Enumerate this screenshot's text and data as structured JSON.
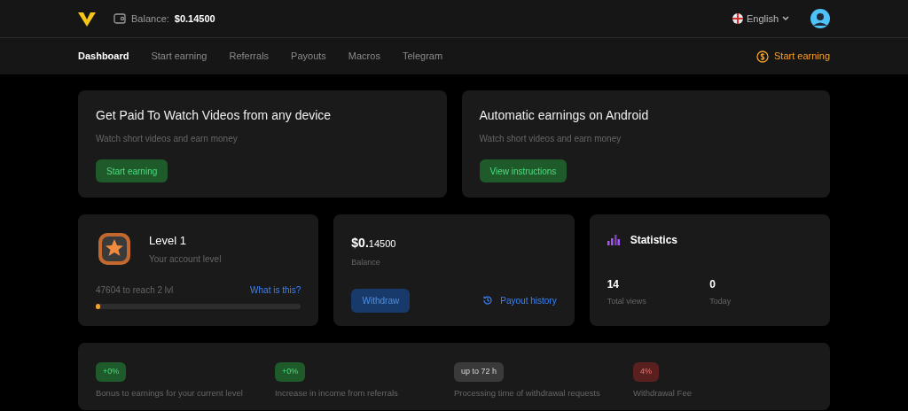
{
  "header": {
    "balance_label": "Balance:",
    "balance_value": "$0.14500",
    "language": "English"
  },
  "nav": {
    "items": [
      {
        "label": "Dashboard",
        "selected": true
      },
      {
        "label": "Start earning",
        "selected": false
      },
      {
        "label": "Referrals",
        "selected": false
      },
      {
        "label": "Payouts",
        "selected": false
      },
      {
        "label": "Macros",
        "selected": false
      },
      {
        "label": "Telegram",
        "selected": false
      }
    ],
    "cta": "Start earning"
  },
  "promos": [
    {
      "title": "Get Paid To Watch Videos from any device",
      "subtitle": "Watch short videos and earn money",
      "button": "Start earning"
    },
    {
      "title": "Automatic earnings on Android",
      "subtitle": "Watch short videos and earn money",
      "button": "View instructions"
    }
  ],
  "level_card": {
    "title": "Level 1",
    "subtitle": "Your account level",
    "progress_text": "47604 to reach 2 lvl",
    "link": "What is this?",
    "level": 0.01
  },
  "balance_card": {
    "amount_main": "$0.",
    "amount_fraction": "14500",
    "label": "Balance",
    "button": "Withdraw",
    "link": "Payout history"
  },
  "statistics": {
    "title": "Statistics",
    "items": [
      {
        "value": "14",
        "label": "Total views"
      },
      {
        "value": "0",
        "label": "Today"
      }
    ]
  },
  "info": [
    {
      "badge": "+0%",
      "kind": "positive",
      "label": "Bonus to earnings for your current level"
    },
    {
      "badge": "+0%",
      "kind": "positive",
      "label": "Increase in income from referrals"
    },
    {
      "badge": "up to 72 h",
      "kind": "neutral",
      "label": "Processing time of withdrawal requests"
    },
    {
      "badge": "4%",
      "kind": "negative",
      "label": "Withdrawal Fee"
    }
  ]
}
